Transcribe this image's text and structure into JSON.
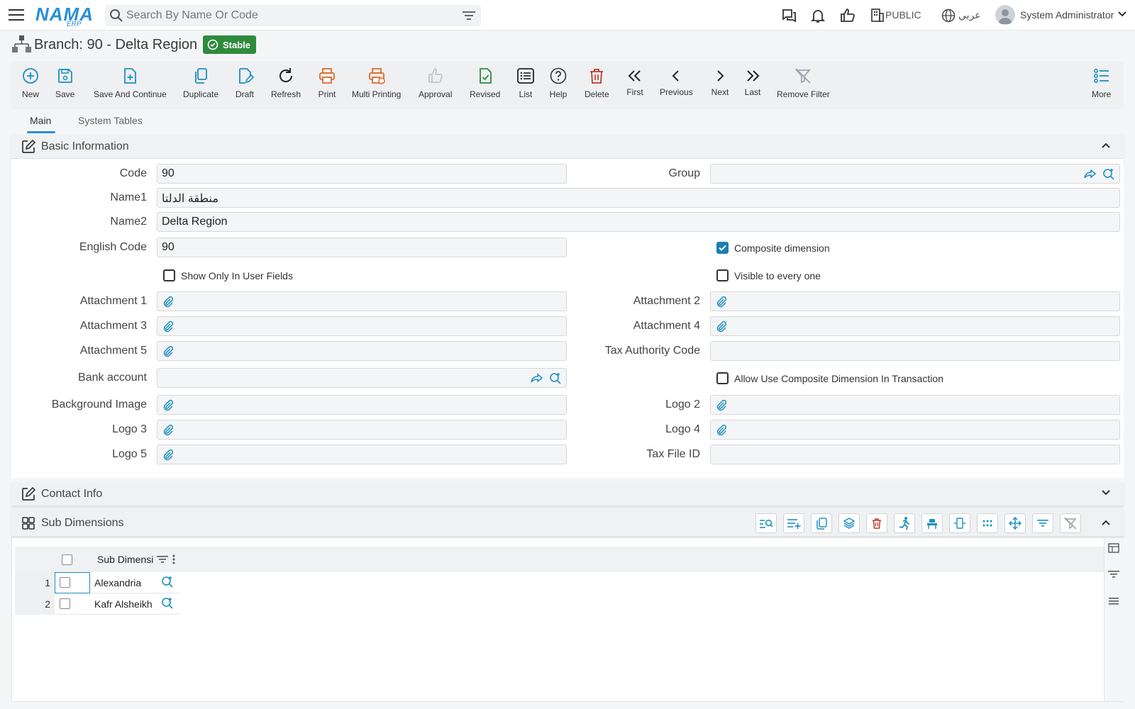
{
  "header": {
    "logo_text": "NAMA",
    "logo_sub": "ERP",
    "search_placeholder": "Search By Name Or Code",
    "public_label": "PUBLIC",
    "language_label": "عربي",
    "user_name": "System Administrator"
  },
  "page": {
    "title": "Branch: 90 - Delta Region",
    "status_badge": "Stable"
  },
  "toolbar": {
    "new": "New",
    "save": "Save",
    "save_continue": "Save And Continue",
    "duplicate": "Duplicate",
    "draft": "Draft",
    "refresh": "Refresh",
    "print": "Print",
    "multi_printing": "Multi Printing",
    "approval": "Approval",
    "revised": "Revised",
    "list": "List",
    "help": "Help",
    "delete": "Delete",
    "first": "First",
    "previous": "Previous",
    "next": "Next",
    "last": "Last",
    "remove_filter": "Remove Filter",
    "more": "More"
  },
  "tabs": {
    "main": "Main",
    "system_tables": "System Tables"
  },
  "sections": {
    "basic_info": "Basic Information",
    "contact_info": "Contact Info",
    "sub_dimensions": "Sub Dimensions"
  },
  "form": {
    "code_label": "Code",
    "code_value": "90",
    "group_label": "Group",
    "group_value": "",
    "name1_label": "Name1",
    "name1_value": "منطقة الدلتا",
    "name2_label": "Name2",
    "name2_value": "Delta Region",
    "english_code_label": "English Code",
    "english_code_value": "90",
    "composite_dimension_label": "Composite dimension",
    "composite_dimension_checked": true,
    "show_only_user_fields_label": "Show Only In User Fields",
    "visible_everyone_label": "Visible to every one",
    "attachment1_label": "Attachment 1",
    "attachment2_label": "Attachment 2",
    "attachment3_label": "Attachment 3",
    "attachment4_label": "Attachment 4",
    "attachment5_label": "Attachment 5",
    "tax_authority_code_label": "Tax Authority Code",
    "bank_account_label": "Bank account",
    "allow_composite_label": "Allow Use Composite Dimension In Transaction",
    "background_image_label": "Background Image",
    "logo2_label": "Logo 2",
    "logo3_label": "Logo 3",
    "logo4_label": "Logo 4",
    "logo5_label": "Logo 5",
    "tax_file_id_label": "Tax File ID"
  },
  "grid": {
    "column_header": "Sub Dimensi",
    "rows": [
      {
        "num": "1",
        "name": "Alexandria"
      },
      {
        "num": "2",
        "name": "Kafr Alsheikh"
      }
    ]
  },
  "colors": {
    "accent": "#2c8fd6",
    "icon_blue": "#1b8fc0",
    "icon_green": "#2e8b3e",
    "icon_orange": "#e06a2c",
    "icon_red": "#c0392b",
    "badge_green": "#2e8b3e"
  }
}
